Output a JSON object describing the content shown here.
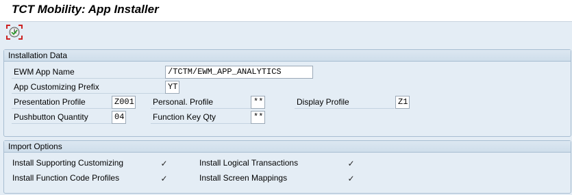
{
  "window": {
    "title": "TCT Mobility: App Installer"
  },
  "toolbar": {
    "execute_icon": "execute-clock-icon"
  },
  "installation": {
    "header": "Installation Data",
    "ewm_app_name_label": "EWM App Name",
    "ewm_app_name_value": "/TCTM/EWM_APP_ANALYTICS",
    "prefix_label": "App Customizing Prefix",
    "prefix_value": "YT",
    "presentation_label": "Presentation Profile",
    "presentation_value": "Z001",
    "personal_label": "Personal. Profile",
    "personal_value": "**",
    "display_label": "Display Profile",
    "display_value": "Z1",
    "pushbutton_label": "Pushbutton Quantity",
    "pushbutton_value": "04",
    "fkey_label": "Function Key Qty",
    "fkey_value": "**"
  },
  "import": {
    "header": "Import Options",
    "options": [
      {
        "label": "Install Supporting Customizing",
        "checked": true
      },
      {
        "label": "Install Function Code Profiles",
        "checked": true
      },
      {
        "label": "Install Logical Transactions",
        "checked": true
      },
      {
        "label": "Install Screen Mappings",
        "checked": true
      }
    ],
    "check_glyph": "✓"
  }
}
